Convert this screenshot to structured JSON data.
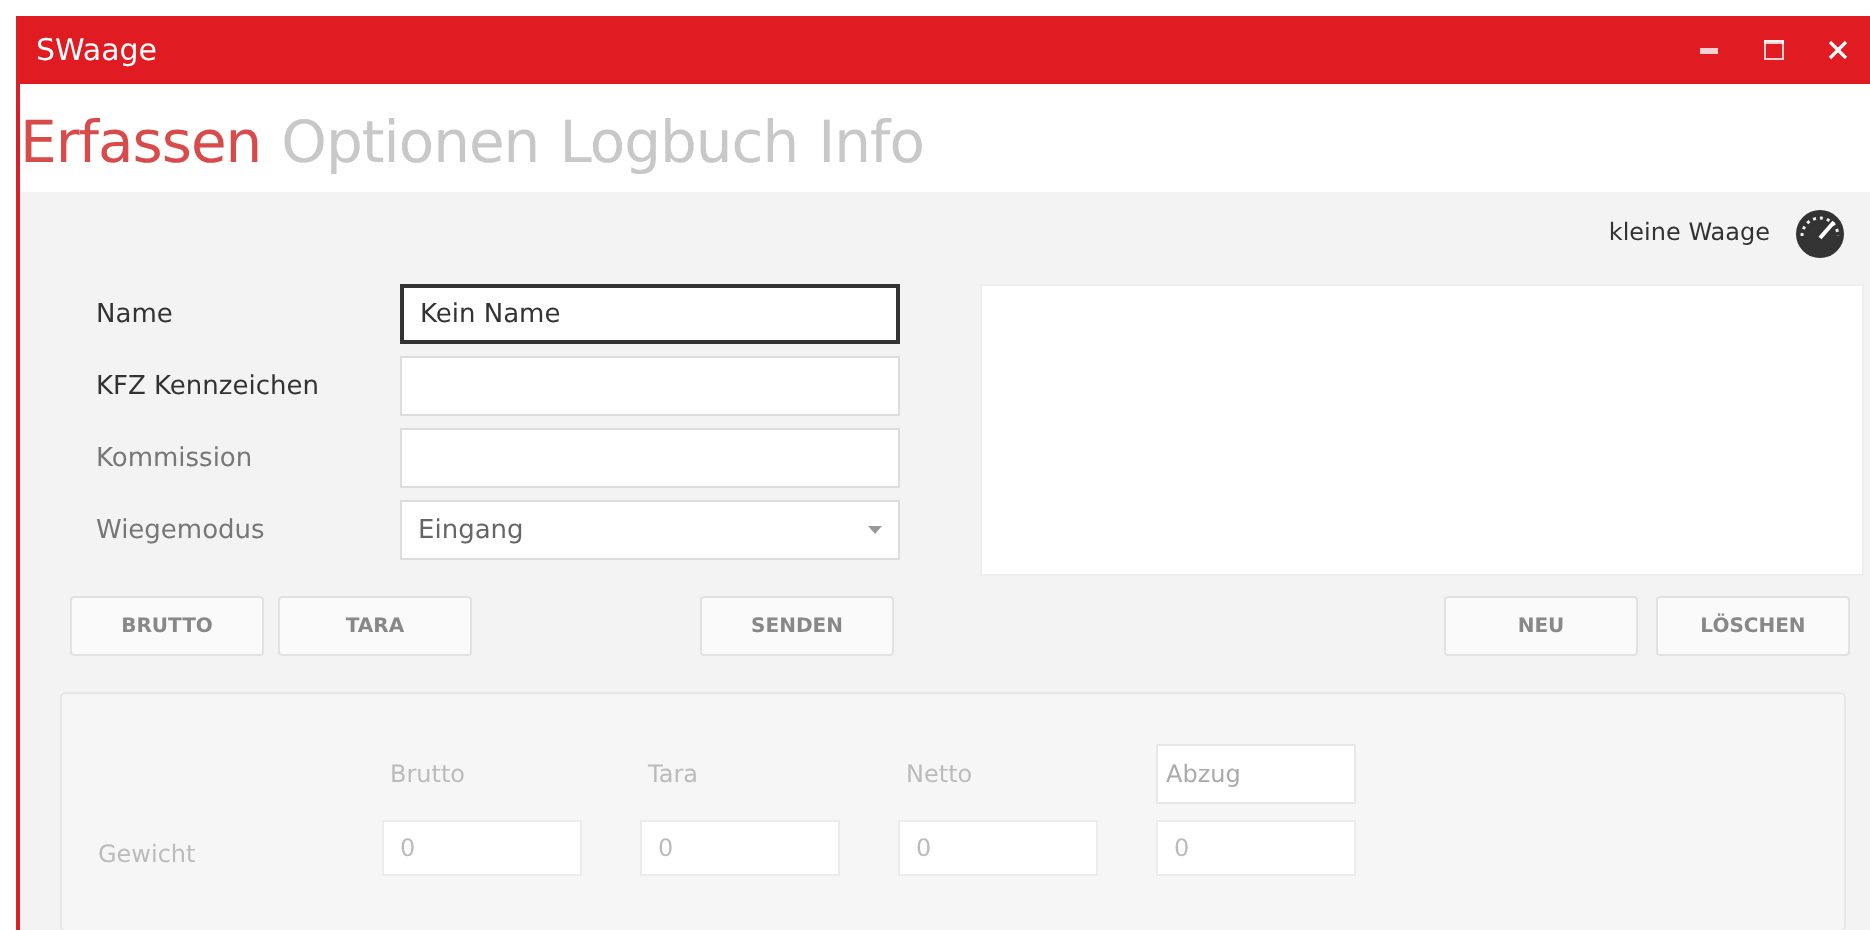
{
  "window": {
    "title": "SWaage"
  },
  "tabs": [
    {
      "label": "Erfassen",
      "selected": true
    },
    {
      "label": "Optionen",
      "selected": false
    },
    {
      "label": "Logbuch",
      "selected": false
    },
    {
      "label": "Info",
      "selected": false
    }
  ],
  "scale": {
    "label": "kleine Waage"
  },
  "form": [
    {
      "label": "Name",
      "kind": "text",
      "value": "Kein Name",
      "focused": true
    },
    {
      "label": "KFZ Kennzeichen",
      "kind": "text",
      "focused": false
    },
    {
      "label": "Kommission",
      "kind": "text",
      "focused": false
    },
    {
      "label": "Wiegemodus",
      "kind": "dropdown",
      "value": "Eingang",
      "focused": false
    }
  ],
  "left_buttons": [
    "BRUTTO",
    "TARA"
  ],
  "send_button": "SENDEN",
  "right_buttons": [
    "NEU",
    "LÖSCHEN"
  ],
  "weights": {
    "columns": [
      {
        "label": "Brutto",
        "kind": "text"
      },
      {
        "label": "Tara",
        "kind": "text"
      },
      {
        "label": "Netto",
        "kind": "text"
      },
      {
        "label": "Abzug",
        "kind": "field"
      }
    ],
    "rows": [
      {
        "label": "Gewicht",
        "values": [
          "0",
          "0",
          "0",
          "0"
        ]
      }
    ]
  }
}
